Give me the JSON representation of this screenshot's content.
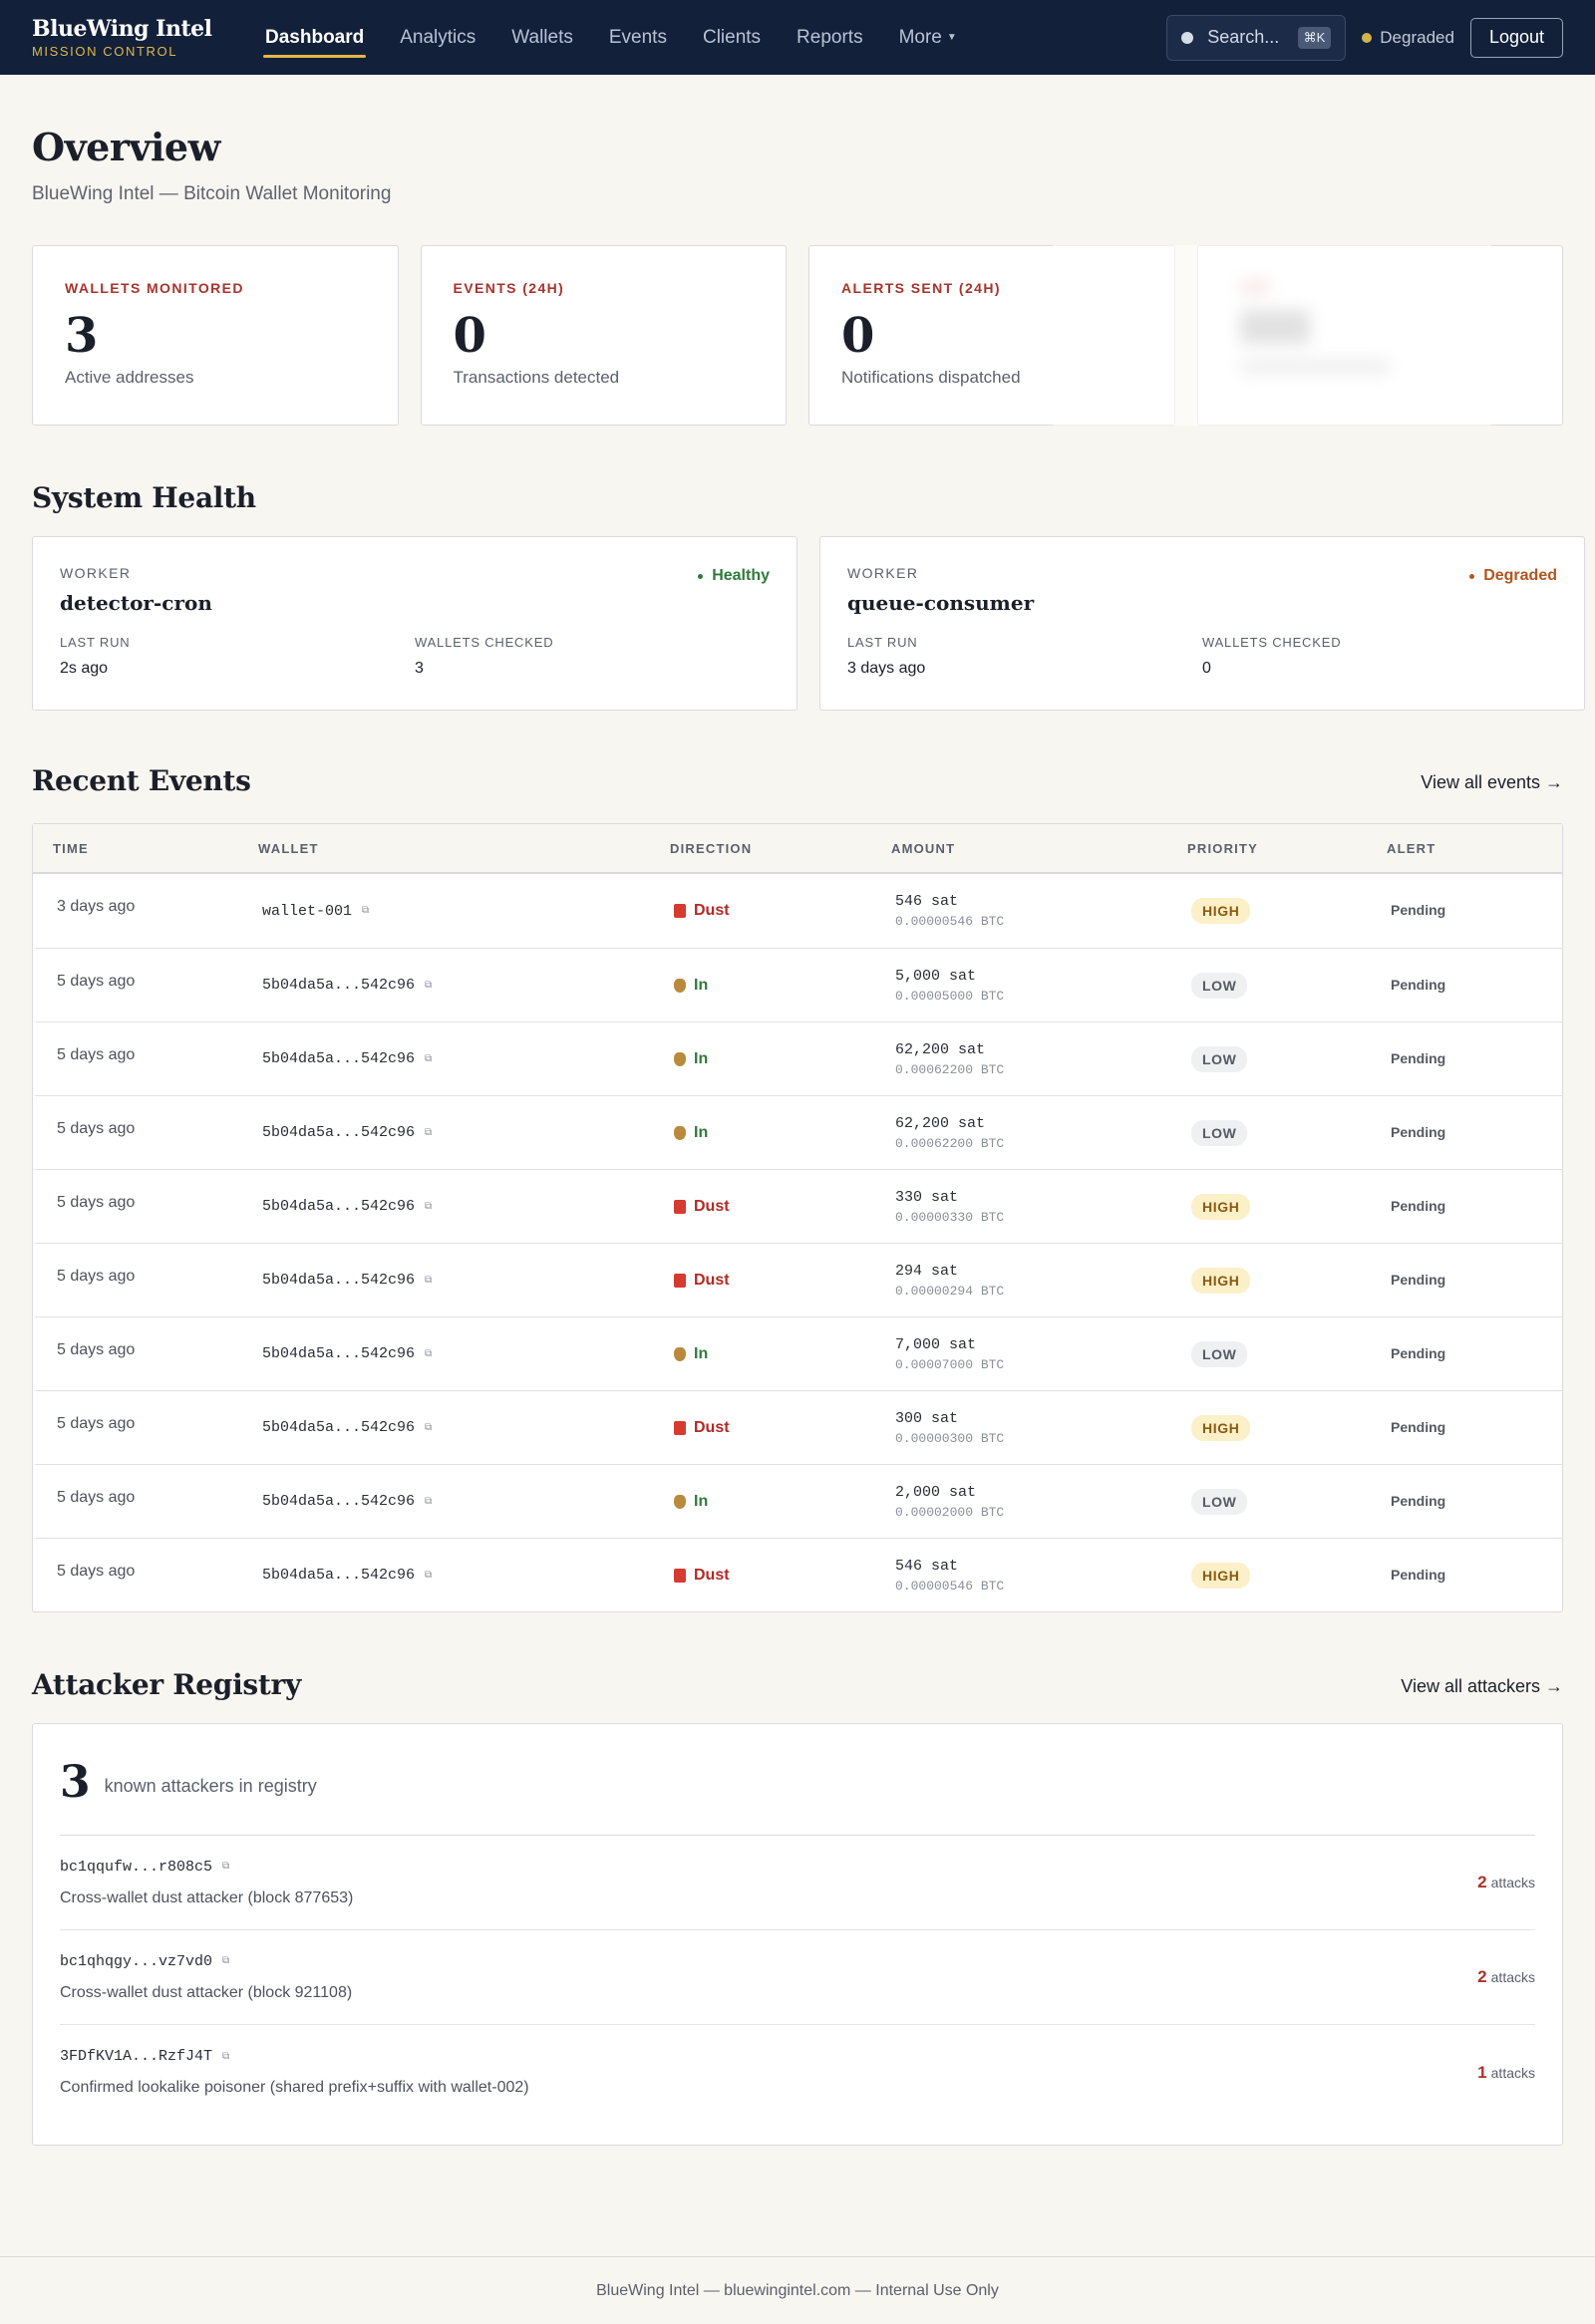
{
  "nav": {
    "brand": "BlueWing Intel",
    "brand_sub": "MISSION CONTROL",
    "links": [
      {
        "label": "Dashboard"
      },
      {
        "label": "Analytics"
      },
      {
        "label": "Wallets"
      },
      {
        "label": "Events"
      },
      {
        "label": "Clients"
      },
      {
        "label": "Reports"
      },
      {
        "label": "More"
      }
    ],
    "search_placeholder": "Search...",
    "search_shortcut": "⌘K",
    "status": "Degraded",
    "logout": "Logout"
  },
  "header": {
    "title": "Overview",
    "subtitle": "BlueWing Intel — Bitcoin Wallet Monitoring"
  },
  "stats": [
    {
      "label": "WALLETS MONITORED",
      "value": "3",
      "desc": "Active addresses"
    },
    {
      "label": "EVENTS (24H)",
      "value": "0",
      "desc": "Transactions detected"
    },
    {
      "label": "ALERTS SENT (24H)",
      "value": "0",
      "desc": "Notifications dispatched"
    }
  ],
  "health": {
    "title": "System Health",
    "workers": [
      {
        "label": "WORKER",
        "name": "detector-cron",
        "state": "Healthy",
        "last_run_label": "LAST RUN",
        "last_run": "2s ago",
        "checked_label": "WALLETS CHECKED",
        "checked": "3"
      },
      {
        "label": "WORKER",
        "name": "queue-consumer",
        "state": "Degraded",
        "last_run_label": "LAST RUN",
        "last_run": "3 days ago",
        "checked_label": "WALLETS CHECKED",
        "checked": "0"
      }
    ]
  },
  "events": {
    "title": "Recent Events",
    "view_all": "View all events →",
    "columns": [
      "TIME",
      "WALLET",
      "DIRECTION",
      "AMOUNT",
      "PRIORITY",
      "ALERT"
    ],
    "rows": [
      {
        "time": "3 days ago",
        "wallet": "wallet-001",
        "direction": "Dust",
        "sat": "546 sat",
        "btc": "0.00000546 BTC",
        "priority": "HIGH",
        "alert": "Pending"
      },
      {
        "time": "5 days ago",
        "wallet": "5b04da5a...542c96",
        "direction": "In",
        "sat": "5,000 sat",
        "btc": "0.00005000 BTC",
        "priority": "LOW",
        "alert": "Pending"
      },
      {
        "time": "5 days ago",
        "wallet": "5b04da5a...542c96",
        "direction": "In",
        "sat": "62,200 sat",
        "btc": "0.00062200 BTC",
        "priority": "LOW",
        "alert": "Pending"
      },
      {
        "time": "5 days ago",
        "wallet": "5b04da5a...542c96",
        "direction": "In",
        "sat": "62,200 sat",
        "btc": "0.00062200 BTC",
        "priority": "LOW",
        "alert": "Pending"
      },
      {
        "time": "5 days ago",
        "wallet": "5b04da5a...542c96",
        "direction": "Dust",
        "sat": "330 sat",
        "btc": "0.00000330 BTC",
        "priority": "HIGH",
        "alert": "Pending"
      },
      {
        "time": "5 days ago",
        "wallet": "5b04da5a...542c96",
        "direction": "Dust",
        "sat": "294 sat",
        "btc": "0.00000294 BTC",
        "priority": "HIGH",
        "alert": "Pending"
      },
      {
        "time": "5 days ago",
        "wallet": "5b04da5a...542c96",
        "direction": "In",
        "sat": "7,000 sat",
        "btc": "0.00007000 BTC",
        "priority": "LOW",
        "alert": "Pending"
      },
      {
        "time": "5 days ago",
        "wallet": "5b04da5a...542c96",
        "direction": "Dust",
        "sat": "300 sat",
        "btc": "0.00000300 BTC",
        "priority": "HIGH",
        "alert": "Pending"
      },
      {
        "time": "5 days ago",
        "wallet": "5b04da5a...542c96",
        "direction": "In",
        "sat": "2,000 sat",
        "btc": "0.00002000 BTC",
        "priority": "LOW",
        "alert": "Pending"
      },
      {
        "time": "5 days ago",
        "wallet": "5b04da5a...542c96",
        "direction": "Dust",
        "sat": "546 sat",
        "btc": "0.00000546 BTC",
        "priority": "HIGH",
        "alert": "Pending"
      }
    ]
  },
  "attackers": {
    "title": "Attacker Registry",
    "view_all": "View all attackers →",
    "count": "3",
    "count_label": "known attackers in registry",
    "attacks_word": "attacks",
    "items": [
      {
        "address": "bc1qqufw...r808c5",
        "desc": "Cross-wallet dust attacker (block 877653)",
        "attacks": "2"
      },
      {
        "address": "bc1qhqgy...vz7vd0",
        "desc": "Cross-wallet dust attacker (block 921108)",
        "attacks": "2"
      },
      {
        "address": "3FDfKV1A...RzfJ4T",
        "desc": "Confirmed lookalike poisoner (shared prefix+suffix with wallet-002)",
        "attacks": "1"
      }
    ]
  },
  "footer": "BlueWing Intel — bluewingintel.com — Internal Use Only"
}
